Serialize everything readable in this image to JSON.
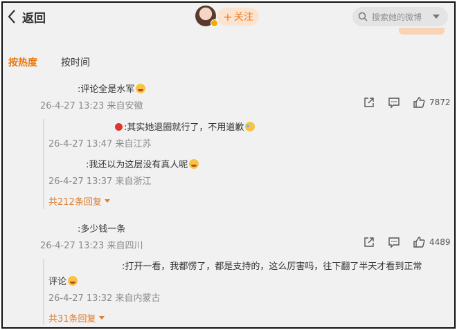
{
  "header": {
    "back_label": "返回",
    "follow_label": "关注",
    "search_placeholder": "搜索她的微博"
  },
  "tabs": {
    "hot": "按热度",
    "time": "按时间"
  },
  "comments": [
    {
      "text": ":评论全是水军",
      "meta": "26-4-27 13:23 来自安徽",
      "likes": "7872",
      "replies": [
        {
          "text": ":其实她退圈就行了，不用道歉",
          "meta": "26-4-27 13:47 来自江苏"
        },
        {
          "text": ":我还以为这层没有真人呢",
          "meta": "26-4-27 13:37 来自浙江"
        }
      ],
      "more": "共212条回复"
    },
    {
      "text": ":多少钱一条",
      "meta": "26-4-27 13:23 来自四川",
      "likes": "4489",
      "replies": [
        {
          "text": ":打开一看，我都愣了，都是支持的，这么厉害吗，往下翻了半天才看到正常",
          "text2": "评论",
          "meta": "26-4-27 13:32 来自内蒙古"
        }
      ],
      "more": "共31条回复"
    }
  ]
}
